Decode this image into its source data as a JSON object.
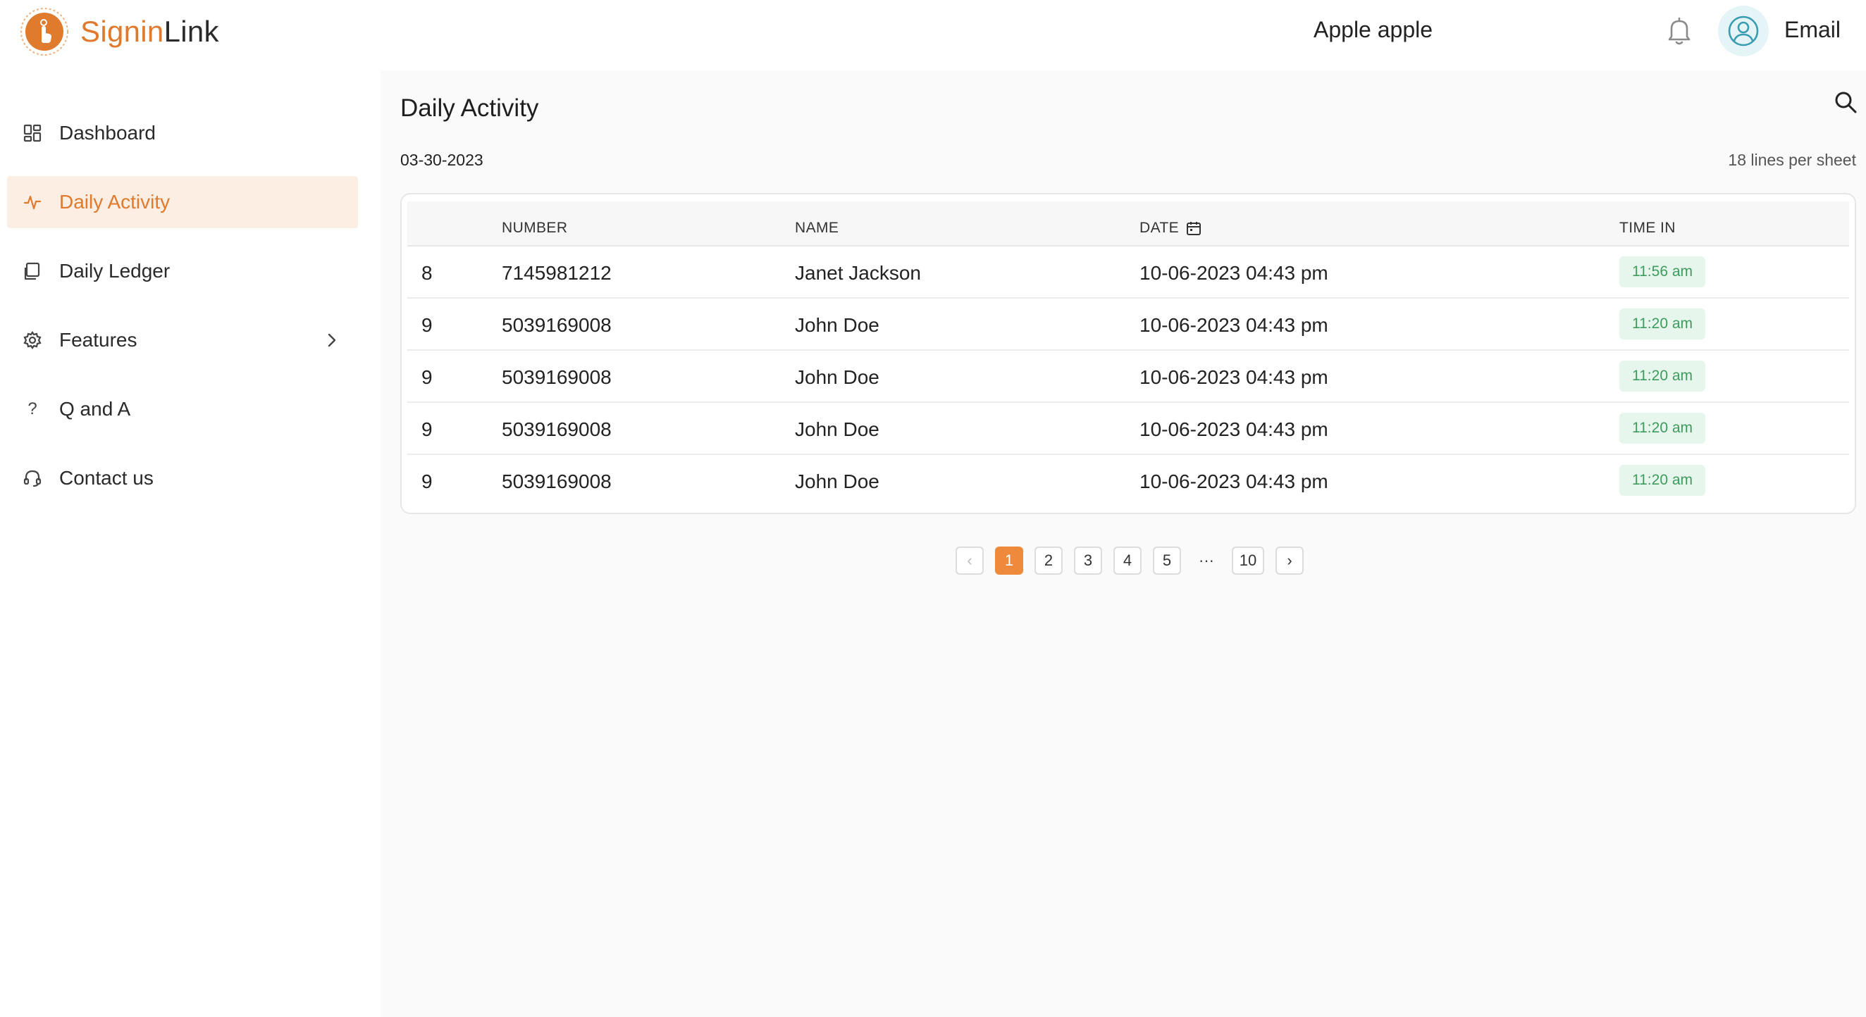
{
  "brand": {
    "name_part1": "Signin",
    "name_part2": "Link",
    "accent": "#e07a2c"
  },
  "header": {
    "user_name": "Apple apple",
    "email_label": "Email",
    "bell_icon": "bell-icon",
    "avatar_icon": "user-circle-icon"
  },
  "sidebar": {
    "items": [
      {
        "label": "Dashboard",
        "icon": "grid-icon",
        "active": false
      },
      {
        "label": "Daily Activity",
        "icon": "activity-icon",
        "active": true
      },
      {
        "label": "Daily Ledger",
        "icon": "ledger-icon",
        "active": false
      },
      {
        "label": "Features",
        "icon": "gear-icon",
        "active": false,
        "has_submenu": true
      },
      {
        "label": "Q and A",
        "icon": "question-icon",
        "active": false
      },
      {
        "label": "Contact us",
        "icon": "headset-icon",
        "active": false
      }
    ]
  },
  "main": {
    "title": "Daily Activity",
    "date": "03-30-2023",
    "lines_per_sheet": "18 lines per sheet",
    "table": {
      "headers": {
        "number": "NUMBER",
        "name": "NAME",
        "date": "DATE",
        "time_in": "TIME IN"
      },
      "rows": [
        {
          "id": "8",
          "number": "7145981212",
          "name": "Janet Jackson",
          "date": "10-06-2023 04:43 pm",
          "time_in": "11:56 am"
        },
        {
          "id": "9",
          "number": "5039169008",
          "name": "John Doe",
          "date": "10-06-2023 04:43 pm",
          "time_in": "11:20 am"
        },
        {
          "id": "9",
          "number": "5039169008",
          "name": "John Doe",
          "date": "10-06-2023 04:43 pm",
          "time_in": "11:20 am"
        },
        {
          "id": "9",
          "number": "5039169008",
          "name": "John Doe",
          "date": "10-06-2023 04:43 pm",
          "time_in": "11:20 am"
        },
        {
          "id": "9",
          "number": "5039169008",
          "name": "John Doe",
          "date": "10-06-2023 04:43 pm",
          "time_in": "11:20 am"
        }
      ]
    },
    "pagination": {
      "prev": "‹",
      "next": "›",
      "pages": [
        "1",
        "2",
        "3",
        "4",
        "5"
      ],
      "ellipsis": "···",
      "last": "10",
      "current": "1"
    }
  },
  "colors": {
    "active_bg": "#fdeee3",
    "badge_bg": "#e7f6ec",
    "badge_text": "#3e9b5e",
    "pager_active": "#ef8a3c"
  }
}
